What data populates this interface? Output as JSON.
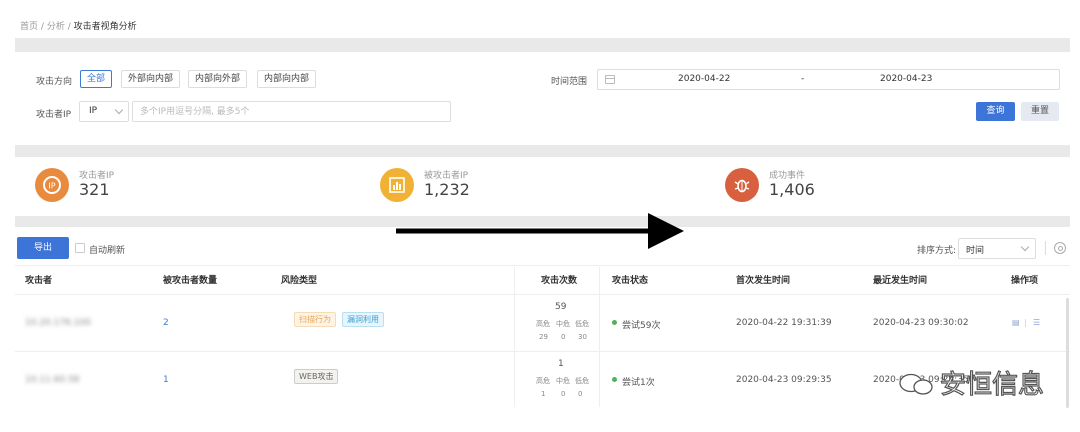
{
  "breadcrumb": {
    "home": "首页",
    "sep1": "/",
    "analysis": "分析",
    "sep2": "/",
    "current": "攻击者视角分析"
  },
  "filters": {
    "direction_label": "攻击方向",
    "direction_options": [
      "全部",
      "外部向内部",
      "内部向外部",
      "内部向内部"
    ],
    "direction_selected": "全部",
    "time_label": "时间范围",
    "date_start": "2020-04-22",
    "date_sep": "-",
    "date_end": "2020-04-23",
    "ip_label": "攻击者IP",
    "ip_type": "IP",
    "ip_placeholder": "多个IP用逗号分隔, 最多5个",
    "search_button": "查询",
    "reset_button": "重置"
  },
  "stats": [
    {
      "label": "攻击者IP",
      "value": "321",
      "color": "#e98b3f",
      "icon": "ip-icon"
    },
    {
      "label": "被攻击者IP",
      "value": "1,232",
      "color": "#f0b135",
      "icon": "chart-icon"
    },
    {
      "label": "成功事件",
      "value": "1,406",
      "color": "#d9603f",
      "icon": "bug-icon"
    }
  ],
  "toolbar": {
    "export_button": "导出",
    "auto_refresh_label": "自动刷新",
    "sort_label": "排序方式:",
    "sort_value": "时间"
  },
  "table": {
    "columns": [
      "攻击者",
      "被攻击者数量",
      "风险类型",
      "攻击次数",
      "攻击状态",
      "首次发生时间",
      "最近发生时间",
      "操作项"
    ],
    "rows": [
      {
        "attacker": "10.20.176.100",
        "victim_count": "2",
        "risk_tags": [
          "扫描行为",
          "漏洞利用"
        ],
        "attack_total": "59",
        "level_labels": [
          "高危",
          "中危",
          "低危"
        ],
        "level_values": [
          "29",
          "0",
          "30"
        ],
        "status": "尝试59次",
        "first_time": "2020-04-22 19:31:39",
        "last_time": "2020-04-23 09:30:02"
      },
      {
        "attacker": "10.11.60.58",
        "victim_count": "1",
        "risk_tags": [
          "WEB攻击"
        ],
        "attack_total": "1",
        "level_labels": [
          "高危",
          "中危",
          "低危"
        ],
        "level_values": [
          "1",
          "0",
          "0"
        ],
        "status": "尝试1次",
        "first_time": "2020-04-23 09:29:35",
        "last_time": "2020-04-23 09:29:35"
      }
    ]
  },
  "watermark": "安恒信息"
}
